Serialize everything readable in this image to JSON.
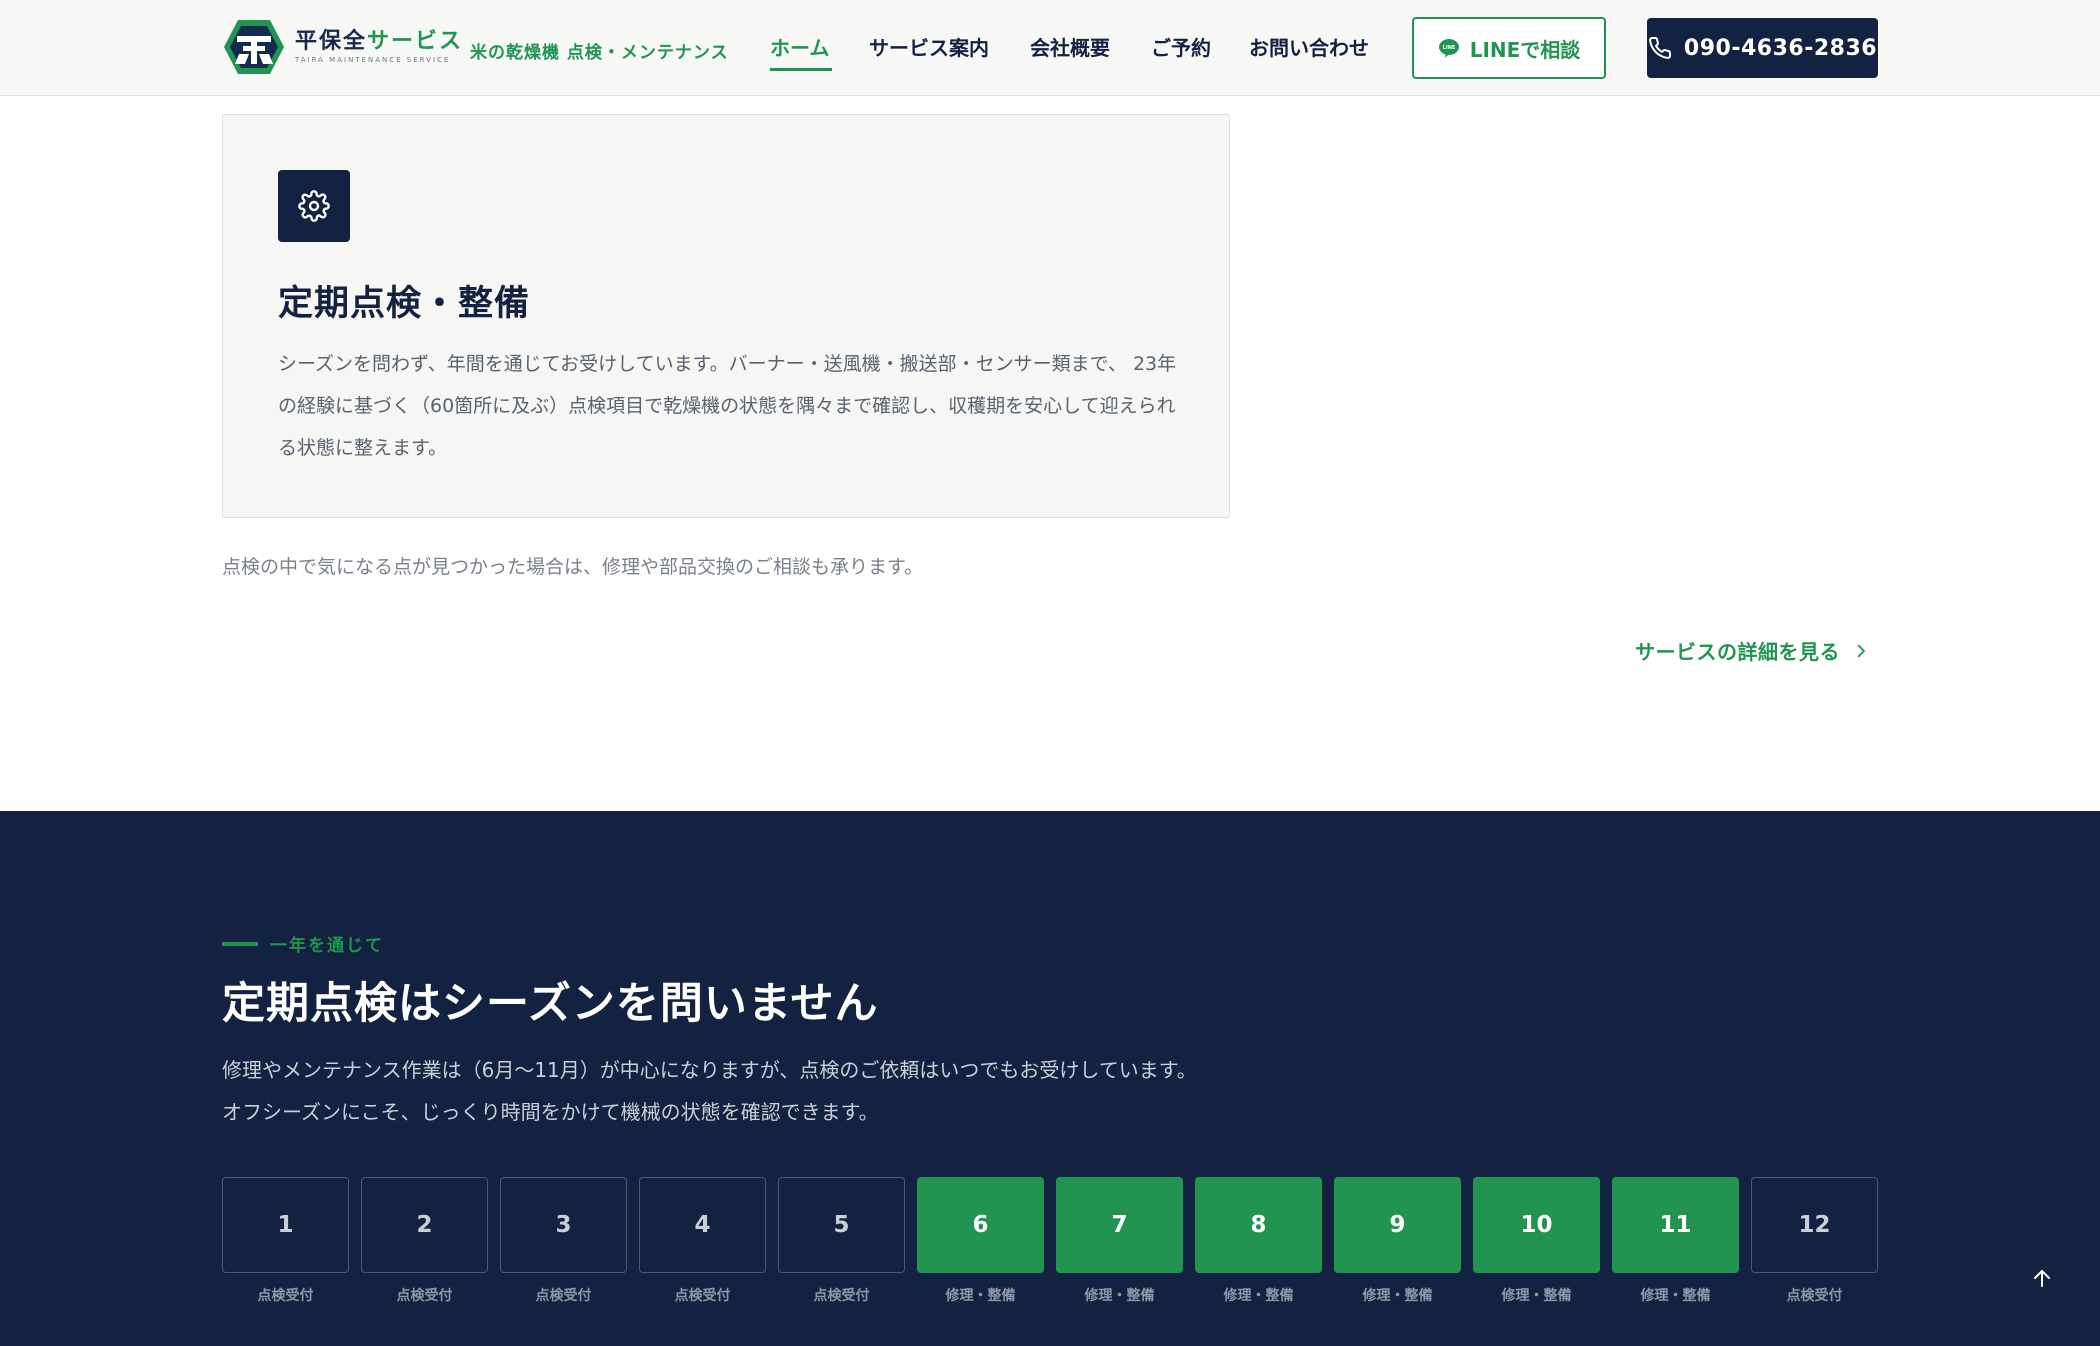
{
  "header": {
    "logo": {
      "name_part1": "平保全",
      "name_part2": "サービス",
      "subtitle": "TAIRA MAINTENANCE SERVICE"
    },
    "tagline": "米の乾燥機 点検・メンテナンス",
    "nav": [
      {
        "label": "ホーム",
        "active": true
      },
      {
        "label": "サービス案内",
        "active": false
      },
      {
        "label": "会社概要",
        "active": false
      },
      {
        "label": "ご予約",
        "active": false
      },
      {
        "label": "お問い合わせ",
        "active": false
      }
    ],
    "line_button": {
      "label": "LINEで相談",
      "icon": "line-chat-icon"
    },
    "phone_button": {
      "label": "090-4636-2836",
      "icon": "phone-icon"
    }
  },
  "card": {
    "icon": "gear-icon",
    "title": "定期点検・整備",
    "description": "シーズンを問わず、年間を通じてお受けしています。バーナー・送風機・搬送部・センサー類まで、 23年の経験に基づく（60箇所に及ぶ）点検項目で乾燥機の状態を隅々まで確認し、収穫期を安心して迎えられる状態に整えます。"
  },
  "note": "点検の中で気になる点が見つかった場合は、修理や部品交換のご相談も承ります。",
  "detail_link": {
    "label": "サービスの詳細を見る",
    "icon": "chevron-right-icon"
  },
  "season": {
    "kicker": "一年を通じて",
    "title": "定期点検はシーズンを問いません",
    "description": "修理やメンテナンス作業は（6月〜11月）が中心になりますが、点検のご依頼はいつでもお受けしています。 オフシーズンにこそ、じっくり時間をかけて機械の状態を確認できます。",
    "months": [
      {
        "number": "1",
        "label": "点検受付",
        "active": false
      },
      {
        "number": "2",
        "label": "点検受付",
        "active": false
      },
      {
        "number": "3",
        "label": "点検受付",
        "active": false
      },
      {
        "number": "4",
        "label": "点検受付",
        "active": false
      },
      {
        "number": "5",
        "label": "点検受付",
        "active": false
      },
      {
        "number": "6",
        "label": "修理・整備",
        "active": true
      },
      {
        "number": "7",
        "label": "修理・整備",
        "active": true
      },
      {
        "number": "8",
        "label": "修理・整備",
        "active": true
      },
      {
        "number": "9",
        "label": "修理・整備",
        "active": true
      },
      {
        "number": "10",
        "label": "修理・整備",
        "active": true
      },
      {
        "number": "11",
        "label": "修理・整備",
        "active": true
      },
      {
        "number": "12",
        "label": "点検受付",
        "active": false
      }
    ]
  },
  "scroll_top": {
    "icon": "arrow-up-icon"
  },
  "colors": {
    "navy": "#132240",
    "green": "#229452",
    "card_bg": "#f6f6f4"
  }
}
